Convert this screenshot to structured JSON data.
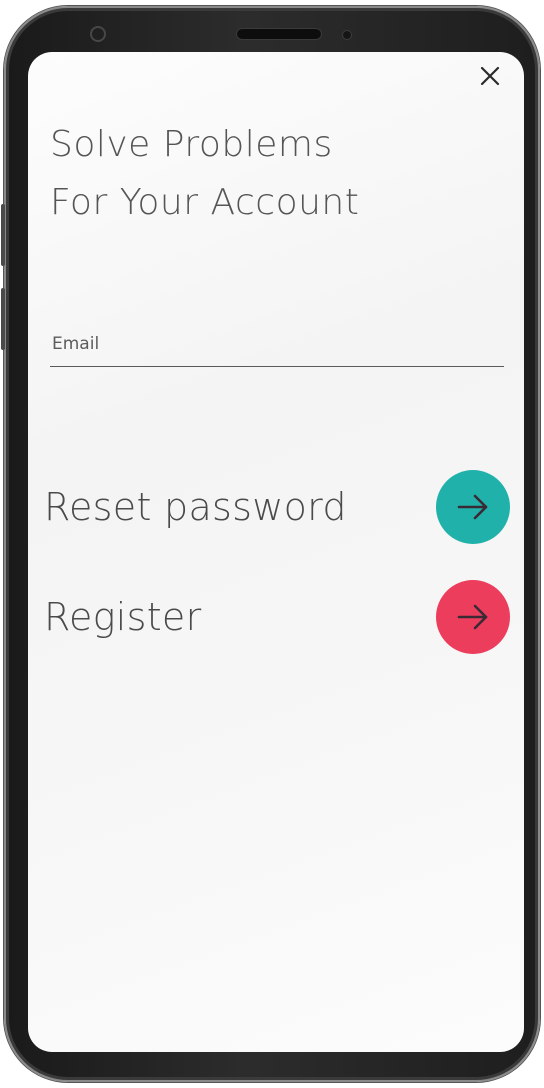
{
  "header": {
    "title_line1": "Solve Problems",
    "title_line2": "For Your Account",
    "close_icon": "close-icon"
  },
  "form": {
    "email_placeholder": "Email",
    "email_value": ""
  },
  "actions": [
    {
      "label": "Reset password",
      "icon": "arrow-right-icon",
      "color": "#20b2aa"
    },
    {
      "label": "Register",
      "icon": "arrow-right-icon",
      "color": "#ec3d5d"
    }
  ],
  "colors": {
    "text": "#4a4a4a",
    "arrow": "#3a2a35"
  }
}
